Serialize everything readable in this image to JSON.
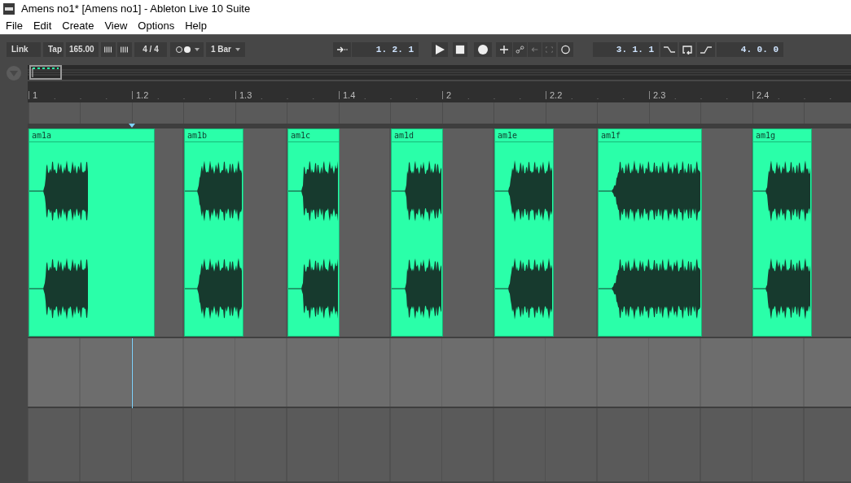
{
  "window": {
    "title": "Amens no1*  [Amens no1] - Ableton Live 10 Suite"
  },
  "menu": [
    "File",
    "Edit",
    "Create",
    "View",
    "Options",
    "Help"
  ],
  "control_bar": {
    "link": "Link",
    "tap": "Tap",
    "tempo": "165.00",
    "signature": "4 / 4",
    "quantization": "1 Bar",
    "song_position": "1.  2.  1",
    "loop_start": "3.  1.  1",
    "loop_length": "4.  0.  0"
  },
  "ruler": [
    "1",
    "1.2",
    "1.3",
    "1.4",
    "2",
    "2.2",
    "2.3",
    "2.4"
  ],
  "clips": [
    {
      "name": "am1a"
    },
    {
      "name": "am1b"
    },
    {
      "name": "am1c"
    },
    {
      "name": "am1d"
    },
    {
      "name": "am1e"
    },
    {
      "name": "am1f"
    },
    {
      "name": "am1g"
    }
  ]
}
